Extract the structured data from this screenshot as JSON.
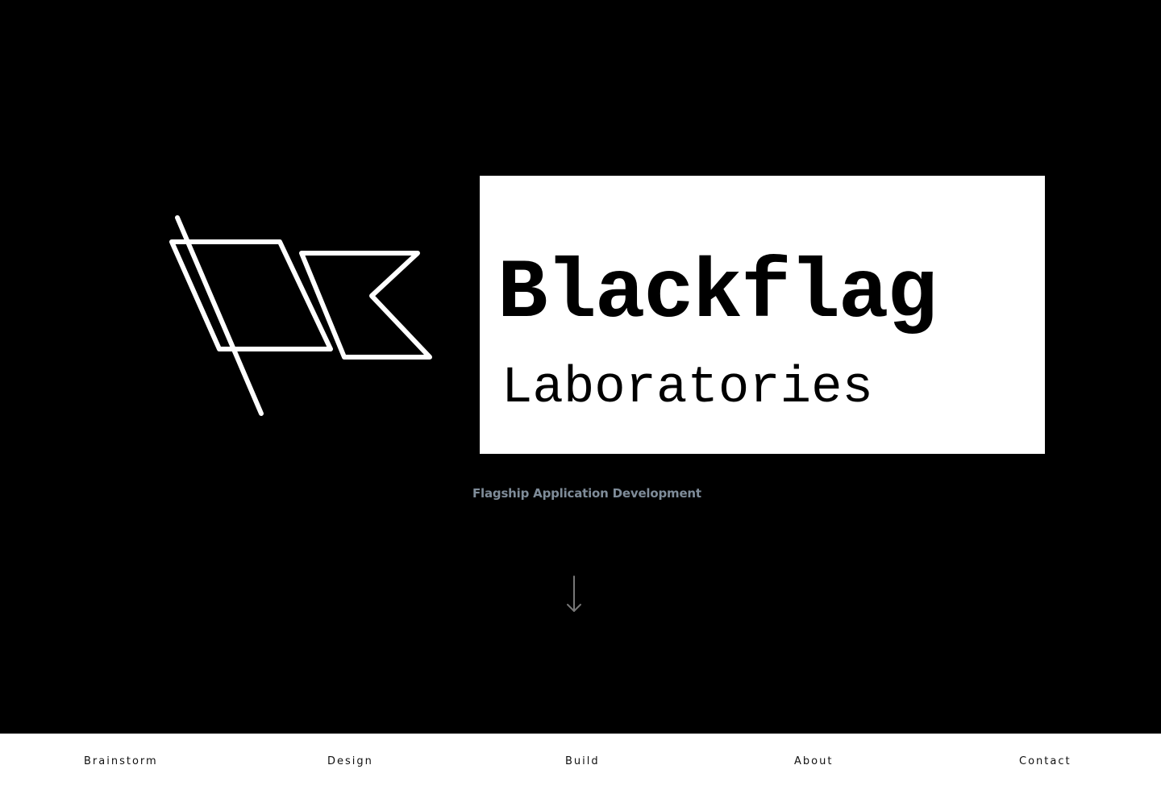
{
  "brand": {
    "name": "Blackflag",
    "subtitle": "Laboratories",
    "tagline": "Flagship Application Development",
    "logo_icon": "flag-outline-icon"
  },
  "scroll_indicator": {
    "icon": "arrow-down-icon"
  },
  "nav": {
    "items": [
      {
        "label": "Brainstorm"
      },
      {
        "label": "Design"
      },
      {
        "label": "Build"
      },
      {
        "label": "About"
      },
      {
        "label": "Contact"
      }
    ]
  },
  "colors": {
    "background": "#000000",
    "wordmark_box": "#ffffff",
    "tagline": "#7f8c99",
    "nav_bar": "#ffffff",
    "nav_text": "#111111",
    "arrow": "#777777"
  }
}
